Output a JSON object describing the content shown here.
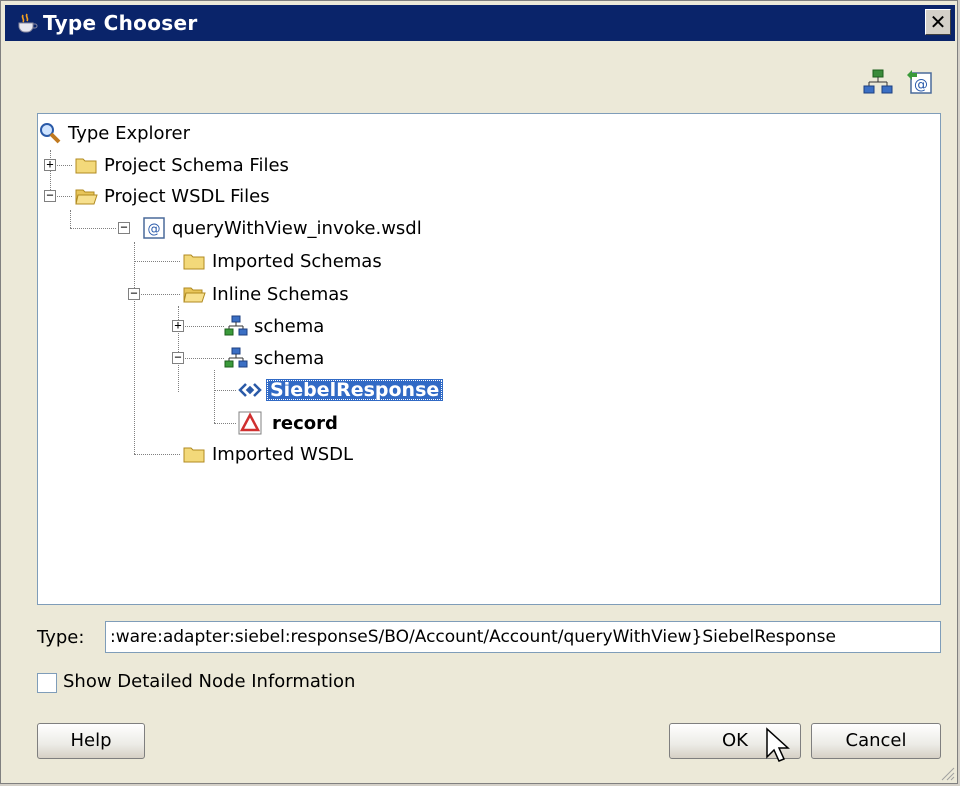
{
  "window": {
    "title": "Type Chooser",
    "close_label": "✕"
  },
  "toolbar": {
    "icons": [
      "schema-tree-icon",
      "wsdl-import-icon"
    ]
  },
  "tree": {
    "root": "Type Explorer",
    "items": [
      {
        "label": "Project Schema Files",
        "expanded": false
      },
      {
        "label": "Project WSDL Files",
        "expanded": true
      },
      {
        "label": "queryWithView_invoke.wsdl",
        "expanded": true
      },
      {
        "label": "Imported Schemas"
      },
      {
        "label": "Inline Schemas",
        "expanded": true
      },
      {
        "label": "schema",
        "expanded": false
      },
      {
        "label": "schema",
        "expanded": true
      },
      {
        "label": "SiebelResponse",
        "selected": true
      },
      {
        "label": "record"
      },
      {
        "label": "Imported WSDL"
      }
    ]
  },
  "type_field": {
    "label": "Type:",
    "value": ":ware:adapter:siebel:responseS/BO/Account/Account/queryWithView}SiebelResponse"
  },
  "checkbox": {
    "label": "Show Detailed Node Information",
    "checked": false
  },
  "buttons": {
    "help": "Help",
    "ok": "OK",
    "cancel": "Cancel"
  },
  "colors": {
    "titlebar": "#0a246a",
    "selection": "#316ac5",
    "dialog_bg": "#ece9d8"
  }
}
